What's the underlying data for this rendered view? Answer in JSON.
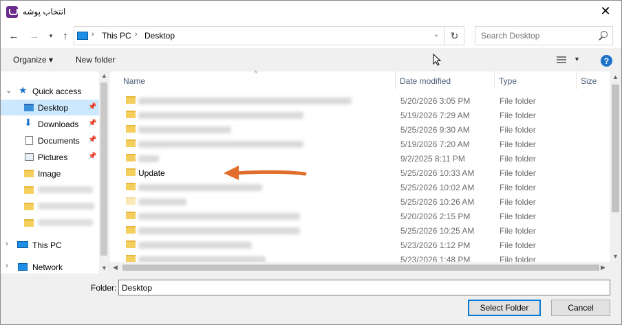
{
  "window": {
    "title": "انتخاب پوشه",
    "close_icon": "close-icon"
  },
  "address": {
    "crumbs": [
      "This PC",
      "Desktop"
    ],
    "search_placeholder": "Search Desktop"
  },
  "toolbar": {
    "organize": "Organize ▾",
    "new_folder": "New folder",
    "help": "?"
  },
  "nav": {
    "quick_access": "Quick access",
    "items": [
      {
        "label": "Desktop",
        "icon": "desktop-icon",
        "pinned": true,
        "selected": true
      },
      {
        "label": "Downloads",
        "icon": "download-icon",
        "pinned": true
      },
      {
        "label": "Documents",
        "icon": "documents-icon",
        "pinned": true
      },
      {
        "label": "Pictures",
        "icon": "pictures-icon",
        "pinned": true
      },
      {
        "label": "Image",
        "icon": "folder-icon"
      }
    ],
    "this_pc": "This PC",
    "network": "Network"
  },
  "columns": {
    "name": "Name",
    "date": "Date modified",
    "type": "Type",
    "size": "Size"
  },
  "files": [
    {
      "name": "",
      "date": "5/20/2026 3:05 PM",
      "type": "File folder"
    },
    {
      "name": "",
      "date": "5/19/2026 7:29 AM",
      "type": "File folder"
    },
    {
      "name": "",
      "date": "5/25/2026 9:30 AM",
      "type": "File folder"
    },
    {
      "name": "",
      "date": "5/19/2026 7:20 AM",
      "type": "File folder"
    },
    {
      "name": "",
      "date": "9/2/2025 8:11 PM",
      "type": "File folder"
    },
    {
      "name": "Update",
      "date": "5/25/2026 10:33 AM",
      "type": "File folder"
    },
    {
      "name": "",
      "date": "5/25/2026 10:02 AM",
      "type": "File folder"
    },
    {
      "name": "",
      "date": "5/25/2026 10:26 AM",
      "type": "File folder"
    },
    {
      "name": "",
      "date": "5/20/2026 2:15 PM",
      "type": "File folder"
    },
    {
      "name": "",
      "date": "5/25/2026 10:25 AM",
      "type": "File folder"
    },
    {
      "name": "",
      "date": "5/23/2026 1:12 PM",
      "type": "File folder"
    },
    {
      "name": "",
      "date": "5/23/2026 1:48 PM",
      "type": "File folder"
    }
  ],
  "footer": {
    "folder_label": "Folder:",
    "folder_value": "Desktop",
    "select_button": "Select Folder",
    "cancel_button": "Cancel"
  },
  "colors": {
    "accent": "#0078d7",
    "selection": "#cce8ff",
    "folder": "#f4cf5e",
    "annotation_arrow": "#e06d2b"
  }
}
